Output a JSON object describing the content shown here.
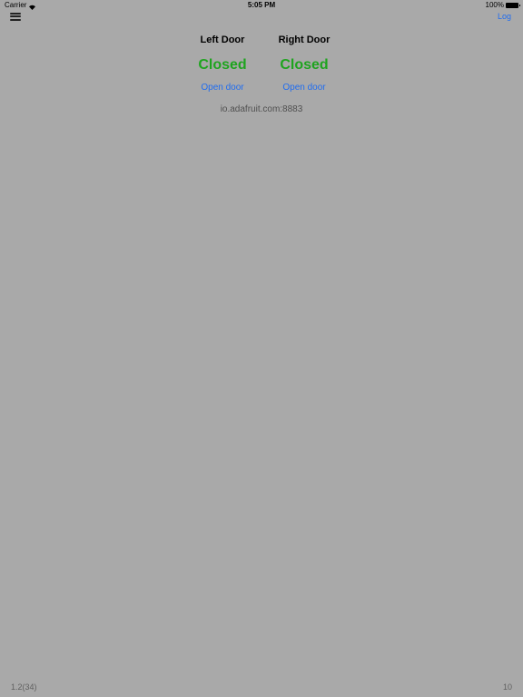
{
  "status_bar": {
    "carrier": "Carrier",
    "time": "5:05 PM",
    "battery": "100%"
  },
  "nav": {
    "menu_icon": "hamburger-menu-icon",
    "log_label": "Log"
  },
  "doors": {
    "left": {
      "title": "Left Door",
      "status": "Closed",
      "action": "Open door"
    },
    "right": {
      "title": "Right Door",
      "status": "Closed",
      "action": "Open door"
    }
  },
  "server": "io.adafruit.com:8883",
  "footer": {
    "version": "1.2(34)",
    "count": "10"
  },
  "colors": {
    "background": "#a9a9a9",
    "status_closed": "#1fa41f",
    "link": "#1f6cf0"
  }
}
